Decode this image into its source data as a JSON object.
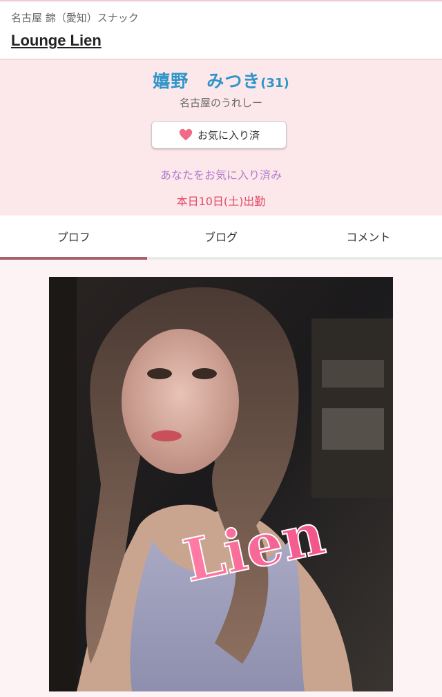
{
  "header": {
    "shop_meta": "名古屋 錦（愛知）スナック",
    "shop_name": "Lounge Lien"
  },
  "profile": {
    "cast_name": "嬉野　みつき",
    "cast_age": "(31)",
    "catchphrase": "名古屋のうれしー",
    "favorite_button_label": "お気に入り済",
    "favorite_status": "あなたをお気に入り済み",
    "attendance": "本日10日(土)出勤"
  },
  "tabs": [
    {
      "label": "プロフ",
      "active": true
    },
    {
      "label": "ブログ",
      "active": false
    },
    {
      "label": "コメント",
      "active": false
    }
  ],
  "photo": {
    "watermark_text": "Lien"
  },
  "colors": {
    "name_blue": "#2f95c9",
    "heart_pink": "#f06b86",
    "status_purple": "#b27ccc",
    "attendance_red": "#e04a67",
    "tab_active": "#a8616a",
    "profile_bg": "#fce8eb"
  },
  "icons": {
    "favorite": "heart-icon"
  }
}
